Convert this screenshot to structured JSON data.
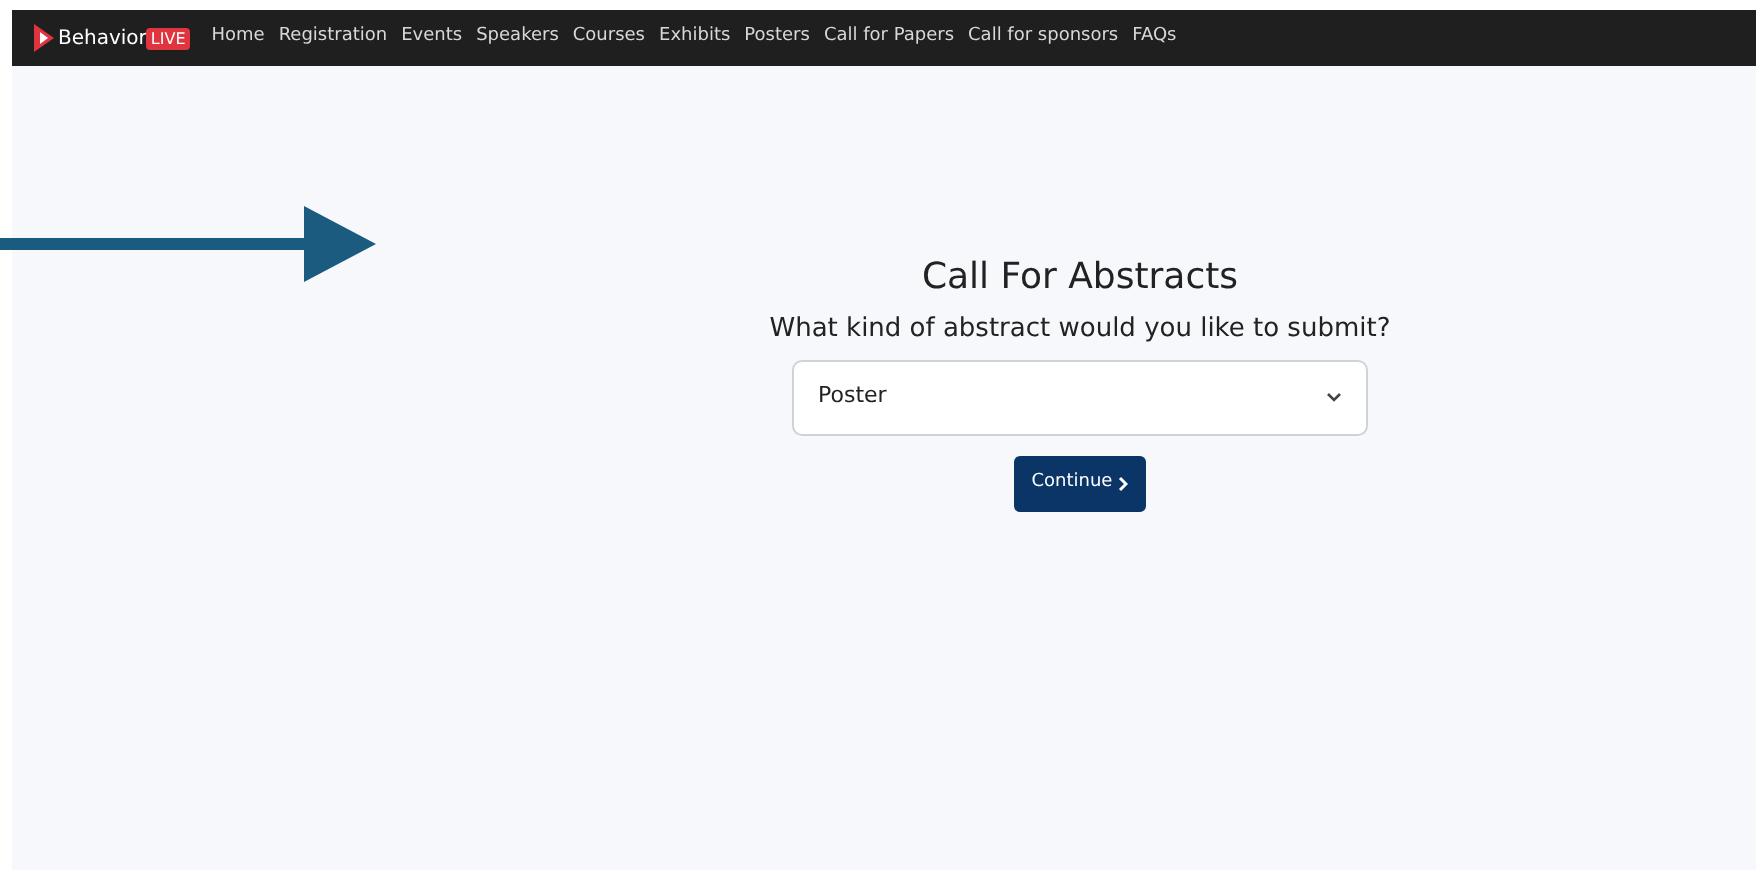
{
  "brand": {
    "name": "Behavior",
    "badge": "LIVE"
  },
  "nav": [
    {
      "label": "Home"
    },
    {
      "label": "Registration"
    },
    {
      "label": "Events"
    },
    {
      "label": "Speakers"
    },
    {
      "label": "Courses"
    },
    {
      "label": "Exhibits"
    },
    {
      "label": "Posters"
    },
    {
      "label": "Call for Papers"
    },
    {
      "label": "Call for sponsors"
    },
    {
      "label": "FAQs"
    }
  ],
  "form": {
    "title": "Call For Abstracts",
    "question": "What kind of abstract would you like to submit?",
    "select_value": "Poster",
    "button": "Continue"
  }
}
